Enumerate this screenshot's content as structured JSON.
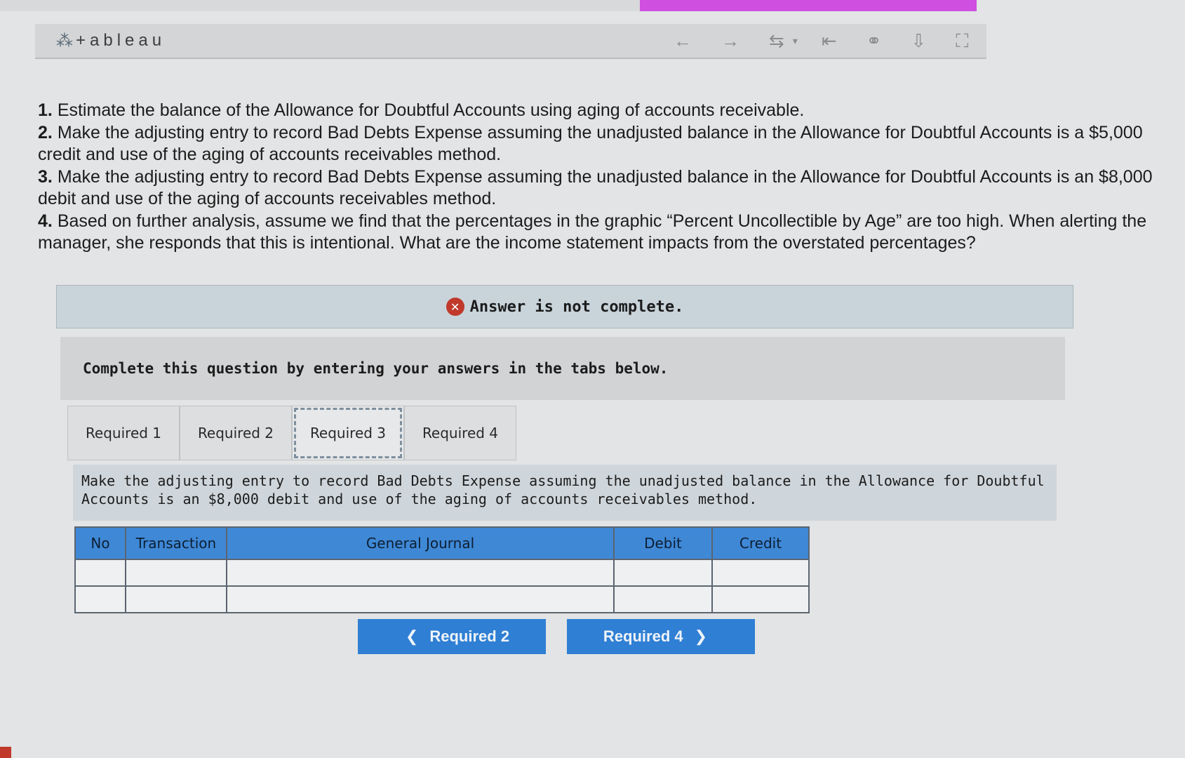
{
  "app": {
    "logo_text": "+ableau"
  },
  "toolbar": {
    "icons": [
      "back-arrow-icon",
      "forward-arrow-icon",
      "revert-icon",
      "dropdown-icon",
      "first-icon",
      "share-icon",
      "download-icon",
      "fullscreen-icon"
    ]
  },
  "instructions": [
    {
      "num": "1.",
      "text": "Estimate the balance of the Allowance for Doubtful Accounts using aging of accounts receivable."
    },
    {
      "num": "2.",
      "text": "Make the adjusting entry to record Bad Debts Expense assuming the unadjusted balance in the Allowance for Doubtful Accounts is a $5,000 credit and use of the aging of accounts receivables method."
    },
    {
      "num": "3.",
      "text": "Make the adjusting entry to record Bad Debts Expense assuming the unadjusted balance in the Allowance for Doubtful Accounts is an $8,000 debit and use of the aging of accounts receivables method."
    },
    {
      "num": "4.",
      "text": "Based on further analysis, assume we find that the percentages in the graphic “Percent Uncollectible by Age” are too high. When alerting the manager, she responds that this is intentional. What are the income statement impacts from the overstated percentages?"
    }
  ],
  "status": {
    "text": "Answer is not complete.",
    "icon": "x-circle-icon",
    "color": "#c0392b"
  },
  "complete_prompt": "Complete this question by entering your answers in the tabs below.",
  "tabs": [
    {
      "label": "Required 1",
      "active": false
    },
    {
      "label": "Required 2",
      "active": false
    },
    {
      "label": "Required 3",
      "active": true
    },
    {
      "label": "Required 4",
      "active": false
    }
  ],
  "question": "Make the adjusting entry to record Bad Debts Expense assuming the unadjusted balance in the Allowance for Doubtful Accounts is an $8,000 debit and use of the aging of accounts receivables method.",
  "journal": {
    "headers": [
      "No",
      "Transaction",
      "General Journal",
      "Debit",
      "Credit"
    ],
    "rows": [
      [
        "",
        "",
        "",
        "",
        ""
      ],
      [
        "",
        "",
        "",
        "",
        ""
      ]
    ],
    "header_color": "#3f88d6"
  },
  "nav": {
    "prev_label": "Required 2",
    "next_label": "Required 4",
    "button_color": "#2f7fd4"
  }
}
